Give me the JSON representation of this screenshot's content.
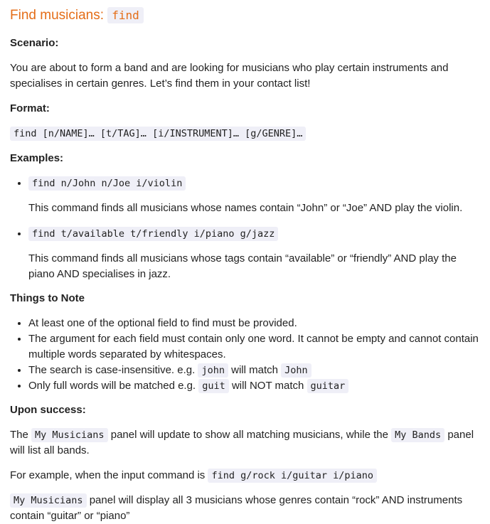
{
  "title": {
    "text": "Find musicians:",
    "code": "find"
  },
  "scenario": {
    "label": "Scenario:",
    "text": "You are about to form a band and are looking for musicians who play certain instruments and specialises in certain genres. Let’s find them in your contact list!"
  },
  "format": {
    "label": "Format:",
    "code": "find [n/NAME]… [t/TAG]… [i/INSTRUMENT]… [g/GENRE]…"
  },
  "examples": {
    "label": "Examples:",
    "items": [
      {
        "code": "find n/John n/Joe i/violin",
        "desc": "This command finds all musicians whose names contain “John” or “Joe” AND play the violin."
      },
      {
        "code": "find t/available t/friendly i/piano g/jazz",
        "desc": "This command finds all musicians whose tags contain “available” or “friendly” AND play the piano AND specialises in jazz."
      }
    ]
  },
  "notes": {
    "label": "Things to Note",
    "item1": "At least one of the optional field to find must be provided.",
    "item2": "The argument for each field must contain only one word. It cannot be empty and cannot contain multiple words separated by whitespaces.",
    "item3": {
      "pre": "The search is case-insensitive. e.g.",
      "code1": "john",
      "mid": "will match",
      "code2": "John"
    },
    "item4": {
      "pre": "Only full words will be matched e.g.",
      "code1": "guit",
      "mid": "will NOT match",
      "code2": "guitar"
    }
  },
  "success": {
    "label": "Upon success:",
    "p1": {
      "pre": "The",
      "code1": "My Musicians",
      "mid": "panel will update to show all matching musicians, while the",
      "code2": "My Bands",
      "post": "panel will list all bands."
    },
    "p2": {
      "pre": "For example, when the input command is",
      "code": "find g/rock i/guitar i/piano"
    },
    "p3": {
      "code": "My Musicians",
      "text": "panel will display all 3 musicians whose genres contain “rock” AND instruments contain “guitar” or “piano”"
    }
  }
}
